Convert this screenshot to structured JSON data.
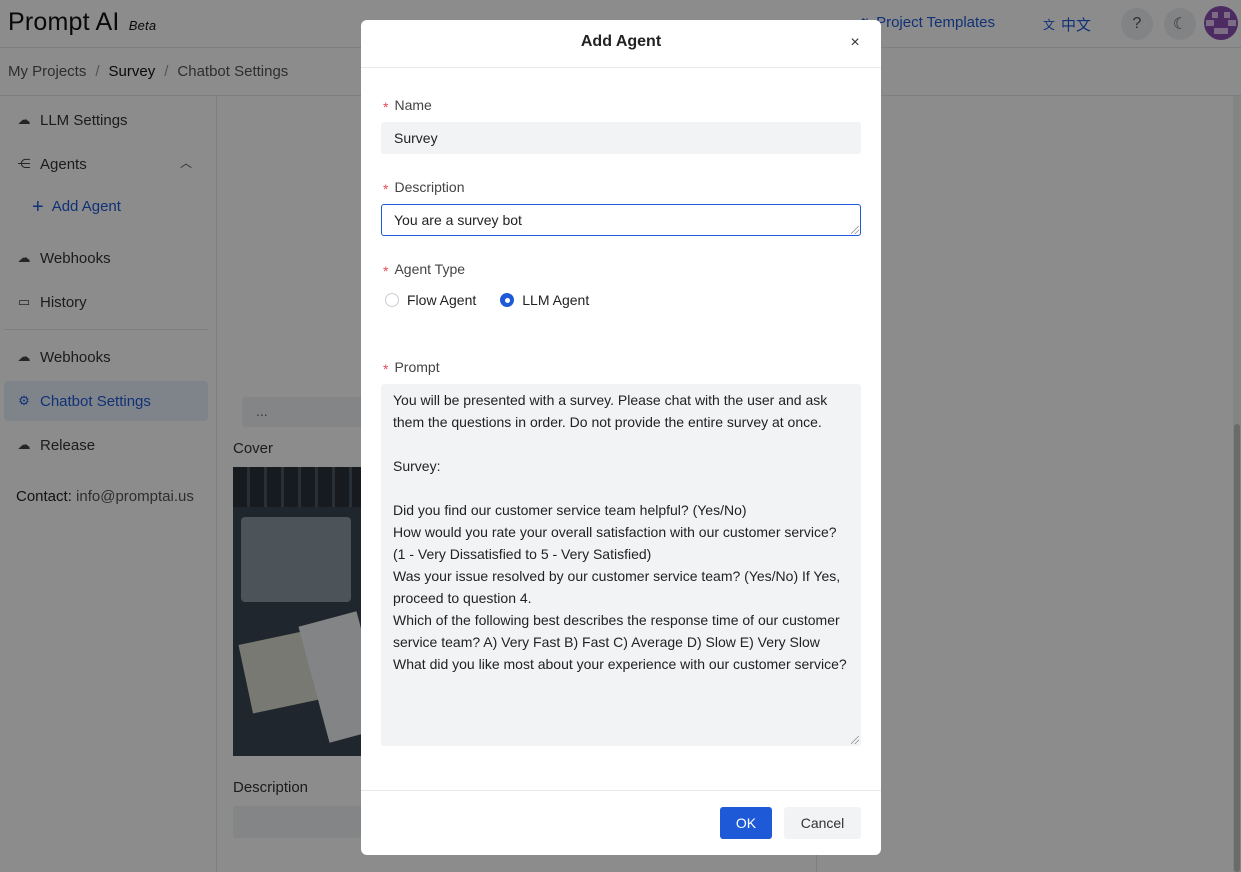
{
  "app": {
    "name": "Prompt AI",
    "badge": "Beta"
  },
  "header": {
    "project_templates": "Project Templates",
    "language": "中文",
    "help_glyph": "?",
    "theme_glyph": "☾"
  },
  "breadcrumb": [
    "My Projects",
    "Survey",
    "Chatbot Settings"
  ],
  "sidebar": {
    "items": [
      {
        "label": "LLM Settings",
        "icon": "cloud-icon"
      },
      {
        "label": "Agents",
        "icon": "agents-icon"
      },
      {
        "label": "Add Agent",
        "icon": "plus-icon"
      },
      {
        "label": "Webhooks",
        "icon": "cloud-icon"
      },
      {
        "label": "History",
        "icon": "history-icon"
      },
      {
        "label": "Webhooks",
        "icon": "cloud-icon"
      },
      {
        "label": "Chatbot Settings",
        "icon": "gear-icon"
      },
      {
        "label": "Release",
        "icon": "release-icon"
      }
    ],
    "contact_label": "Contact:",
    "contact_email": "info@promptai.us"
  },
  "main": {
    "ellipsis": "...",
    "cover_label": "Cover",
    "description_label": "Description"
  },
  "modal": {
    "title": "Add Agent",
    "close_glyph": "×",
    "name_label": "Name",
    "name_value": "Survey",
    "description_label": "Description",
    "description_value": "You are a survey bot",
    "agent_type_label": "Agent Type",
    "agent_types": [
      {
        "label": "Flow Agent",
        "checked": false
      },
      {
        "label": "LLM Agent",
        "checked": true
      }
    ],
    "prompt_label": "Prompt",
    "prompt_value": "You will be presented with a survey. Please chat with the user and ask them the questions in order. Do not provide the entire survey at once.\n\nSurvey:\n\nDid you find our customer service team helpful? (Yes/No)\nHow would you rate your overall satisfaction with our customer service? (1 - Very Dissatisfied to 5 - Very Satisfied)\nWas your issue resolved by our customer service team? (Yes/No) If Yes, proceed to question 4.\nWhich of the following best describes the response time of our customer service team? A) Very Fast B) Fast C) Average D) Slow E) Very Slow\nWhat did you like most about your experience with our customer service?",
    "ok_label": "OK",
    "cancel_label": "Cancel",
    "required_mark": "*"
  },
  "colors": {
    "accent": "#1e5ad8",
    "required": "#e34d59",
    "overlay": "rgba(0,0,0,0.45)"
  }
}
